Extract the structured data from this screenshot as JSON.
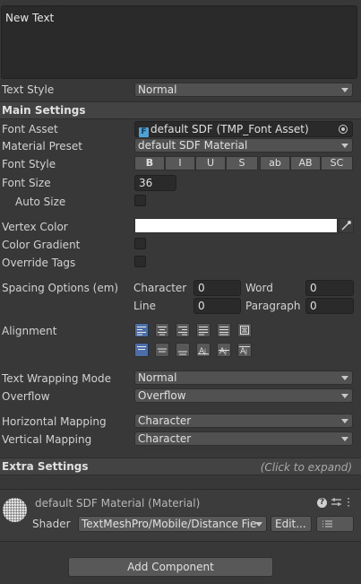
{
  "text_input": {
    "value": "New Text"
  },
  "text_style": {
    "label": "Text Style",
    "value": "Normal"
  },
  "main_settings": {
    "header": "Main Settings",
    "font_asset": {
      "label": "Font Asset",
      "value": "default SDF (TMP_Font Asset)"
    },
    "material_preset": {
      "label": "Material Preset",
      "value": "default SDF Material"
    },
    "font_style": {
      "label": "Font Style",
      "buttons": [
        "B",
        "I",
        "U",
        "S",
        "ab",
        "AB",
        "SC"
      ]
    },
    "font_size": {
      "label": "Font Size",
      "value": "36"
    },
    "auto_size": {
      "label": "Auto Size",
      "checked": false
    },
    "vertex_color": {
      "label": "Vertex Color",
      "color": "#ffffff"
    },
    "color_gradient": {
      "label": "Color Gradient",
      "checked": false
    },
    "override_tags": {
      "label": "Override Tags",
      "checked": false
    },
    "spacing": {
      "label": "Spacing Options (em)",
      "character_label": "Character",
      "character_value": "0",
      "word_label": "Word",
      "word_value": "0",
      "line_label": "Line",
      "line_value": "0",
      "paragraph_label": "Paragraph",
      "paragraph_value": "0"
    },
    "alignment": {
      "label": "Alignment"
    },
    "text_wrapping": {
      "label": "Text Wrapping Mode",
      "value": "Normal"
    },
    "overflow": {
      "label": "Overflow",
      "value": "Overflow"
    },
    "horizontal_mapping": {
      "label": "Horizontal Mapping",
      "value": "Character"
    },
    "vertical_mapping": {
      "label": "Vertical Mapping",
      "value": "Character"
    }
  },
  "extra_settings": {
    "header": "Extra Settings",
    "hint": "(Click to expand)"
  },
  "material": {
    "title": "default SDF Material (Material)",
    "shader_label": "Shader",
    "shader_value": "TextMeshPro/Mobile/Distance Fie",
    "edit_label": "Edit..."
  },
  "add_component": {
    "label": "Add Component"
  },
  "colors": {
    "background": "#383838",
    "accent": "#4b6ea8",
    "field": "#2a2a2a"
  }
}
